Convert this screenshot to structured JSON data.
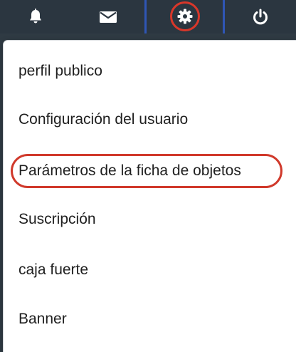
{
  "nav": {
    "items": [
      {
        "icon": "bell-icon"
      },
      {
        "icon": "mail-icon"
      },
      {
        "icon": "gear-icon"
      },
      {
        "icon": "power-icon"
      }
    ],
    "active_border_color": "#2f56b5",
    "highlight_color": "#d8372a"
  },
  "menu": {
    "items": [
      {
        "label": "perfil publico"
      },
      {
        "label": "Configuración del usuario"
      },
      {
        "label": "Parámetros de la ficha de objetos"
      },
      {
        "label": "Suscripción"
      },
      {
        "label": "caja fuerte"
      },
      {
        "label": "Banner"
      }
    ],
    "highlight_color": "#d0392b"
  },
  "colors": {
    "topbar_background": "#2b3640",
    "menu_background": "#ffffff",
    "menu_text": "#1f1f1f"
  }
}
